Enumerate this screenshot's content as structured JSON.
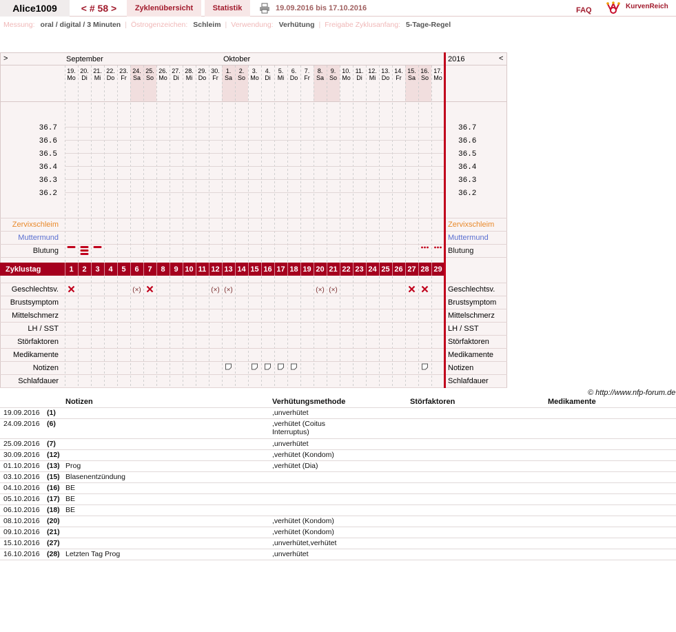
{
  "header": {
    "user": "Alice1009",
    "cycle_label": "< # 58 >",
    "tab_cycles": "Zyklenübersicht",
    "tab_stats": "Statistik",
    "date_range": "19.09.2016 bis 17.10.2016",
    "faq": "FAQ",
    "logo": "KurvenReich"
  },
  "settings": [
    {
      "label": "Messung:",
      "value": "oral / digital / 3 Minuten"
    },
    {
      "label": "Östrogenzeichen:",
      "value": "Schleim"
    },
    {
      "label": "Verwendung:",
      "value": "Verhütung"
    },
    {
      "label": "Freigabe Zyklusanfang:",
      "value": "5-Tage-Regel"
    }
  ],
  "chart_data": {
    "type": "table",
    "nav_left": ">",
    "nav_right": "<",
    "year": "2016",
    "months": [
      {
        "name": "September",
        "start": 0
      },
      {
        "name": "Oktober",
        "start": 12
      }
    ],
    "days": [
      {
        "d": "19.",
        "w": "Mo"
      },
      {
        "d": "20.",
        "w": "Di"
      },
      {
        "d": "21.",
        "w": "Mi"
      },
      {
        "d": "22.",
        "w": "Do"
      },
      {
        "d": "23.",
        "w": "Fr"
      },
      {
        "d": "24.",
        "w": "Sa"
      },
      {
        "d": "25.",
        "w": "So"
      },
      {
        "d": "26.",
        "w": "Mo"
      },
      {
        "d": "27.",
        "w": "Di"
      },
      {
        "d": "28.",
        "w": "Mi"
      },
      {
        "d": "29.",
        "w": "Do"
      },
      {
        "d": "30.",
        "w": "Fr"
      },
      {
        "d": "1.",
        "w": "Sa"
      },
      {
        "d": "2.",
        "w": "So"
      },
      {
        "d": "3.",
        "w": "Mo"
      },
      {
        "d": "4.",
        "w": "Di"
      },
      {
        "d": "5.",
        "w": "Mi"
      },
      {
        "d": "6.",
        "w": "Do"
      },
      {
        "d": "7.",
        "w": "Fr"
      },
      {
        "d": "8.",
        "w": "Sa"
      },
      {
        "d": "9.",
        "w": "So"
      },
      {
        "d": "10.",
        "w": "Mo"
      },
      {
        "d": "11.",
        "w": "Di"
      },
      {
        "d": "12.",
        "w": "Mi"
      },
      {
        "d": "13.",
        "w": "Do"
      },
      {
        "d": "14.",
        "w": "Fr"
      },
      {
        "d": "15.",
        "w": "Sa"
      },
      {
        "d": "16.",
        "w": "So"
      },
      {
        "d": "17.",
        "w": "Mo"
      }
    ],
    "temperature_ticks": [
      "36.7",
      "36.6",
      "36.5",
      "36.4",
      "36.3",
      "36.2"
    ],
    "rows_top": [
      "Zervixschleim",
      "Muttermund",
      "Blutung"
    ],
    "cycle_day_label": "Zyklustag",
    "cycle_days": [
      "1",
      "2",
      "3",
      "4",
      "5",
      "6",
      "7",
      "8",
      "9",
      "10",
      "11",
      "12",
      "13",
      "14",
      "15",
      "16",
      "17",
      "18",
      "19",
      "20",
      "21",
      "22",
      "23",
      "24",
      "25",
      "26",
      "27",
      "28",
      "29"
    ],
    "rows_bottom": [
      "Geschlechtsv.",
      "Brustsymptom",
      "Mittelschmerz",
      "LH / SST",
      "Störfaktoren",
      "Medikamente",
      "Notizen",
      "Schlafdauer"
    ],
    "bleeding": [
      {
        "day": 1,
        "level": 1
      },
      {
        "day": 2,
        "level": 2
      },
      {
        "day": 3,
        "level": 1
      },
      {
        "day": 28,
        "level": 0
      },
      {
        "day": 29,
        "level": 0
      }
    ],
    "intercourse": [
      {
        "day": 1,
        "protected": false
      },
      {
        "day": 6,
        "protected": true
      },
      {
        "day": 7,
        "protected": false
      },
      {
        "day": 12,
        "protected": true
      },
      {
        "day": 13,
        "protected": true
      },
      {
        "day": 20,
        "protected": true
      },
      {
        "day": 21,
        "protected": true
      },
      {
        "day": 27,
        "protected": false
      },
      {
        "day": 28,
        "protected": false
      }
    ],
    "notes_days": [
      13,
      15,
      16,
      17,
      18,
      28
    ],
    "colors": {
      "cycle_bar": "#a5001e",
      "divider": "#c0001c",
      "zervix": "#e8892a",
      "muttermund": "#5a6fd0",
      "mark": "#c0001c"
    }
  },
  "credit": "© http://www.nfp-forum.de",
  "notes_table": {
    "headers": [
      "Notizen",
      "Verhütungsmethode",
      "Störfaktoren",
      "Medikamente"
    ],
    "rows": [
      {
        "date": "19.09.2016",
        "day": "(1)",
        "note": "",
        "method": ",unverhütet"
      },
      {
        "date": "24.09.2016",
        "day": "(6)",
        "note": "",
        "method": ",verhütet (Coitus Interruptus)"
      },
      {
        "date": "25.09.2016",
        "day": "(7)",
        "note": "",
        "method": ",unverhütet"
      },
      {
        "date": "30.09.2016",
        "day": "(12)",
        "note": "",
        "method": ",verhütet (Kondom)"
      },
      {
        "date": "01.10.2016",
        "day": "(13)",
        "note": "Prog",
        "method": ",verhütet (Dia)"
      },
      {
        "date": "03.10.2016",
        "day": "(15)",
        "note": "Blasenentzündung",
        "method": ""
      },
      {
        "date": "04.10.2016",
        "day": "(16)",
        "note": "BE",
        "method": ""
      },
      {
        "date": "05.10.2016",
        "day": "(17)",
        "note": "BE",
        "method": ""
      },
      {
        "date": "06.10.2016",
        "day": "(18)",
        "note": "BE",
        "method": ""
      },
      {
        "date": "08.10.2016",
        "day": "(20)",
        "note": "",
        "method": ",verhütet (Kondom)"
      },
      {
        "date": "09.10.2016",
        "day": "(21)",
        "note": "",
        "method": ",verhütet (Kondom)"
      },
      {
        "date": "15.10.2016",
        "day": "(27)",
        "note": "",
        "method": ",unverhütet,verhütet"
      },
      {
        "date": "16.10.2016",
        "day": "(28)",
        "note": "Letzten Tag Prog",
        "method": ",unverhütet"
      }
    ]
  }
}
